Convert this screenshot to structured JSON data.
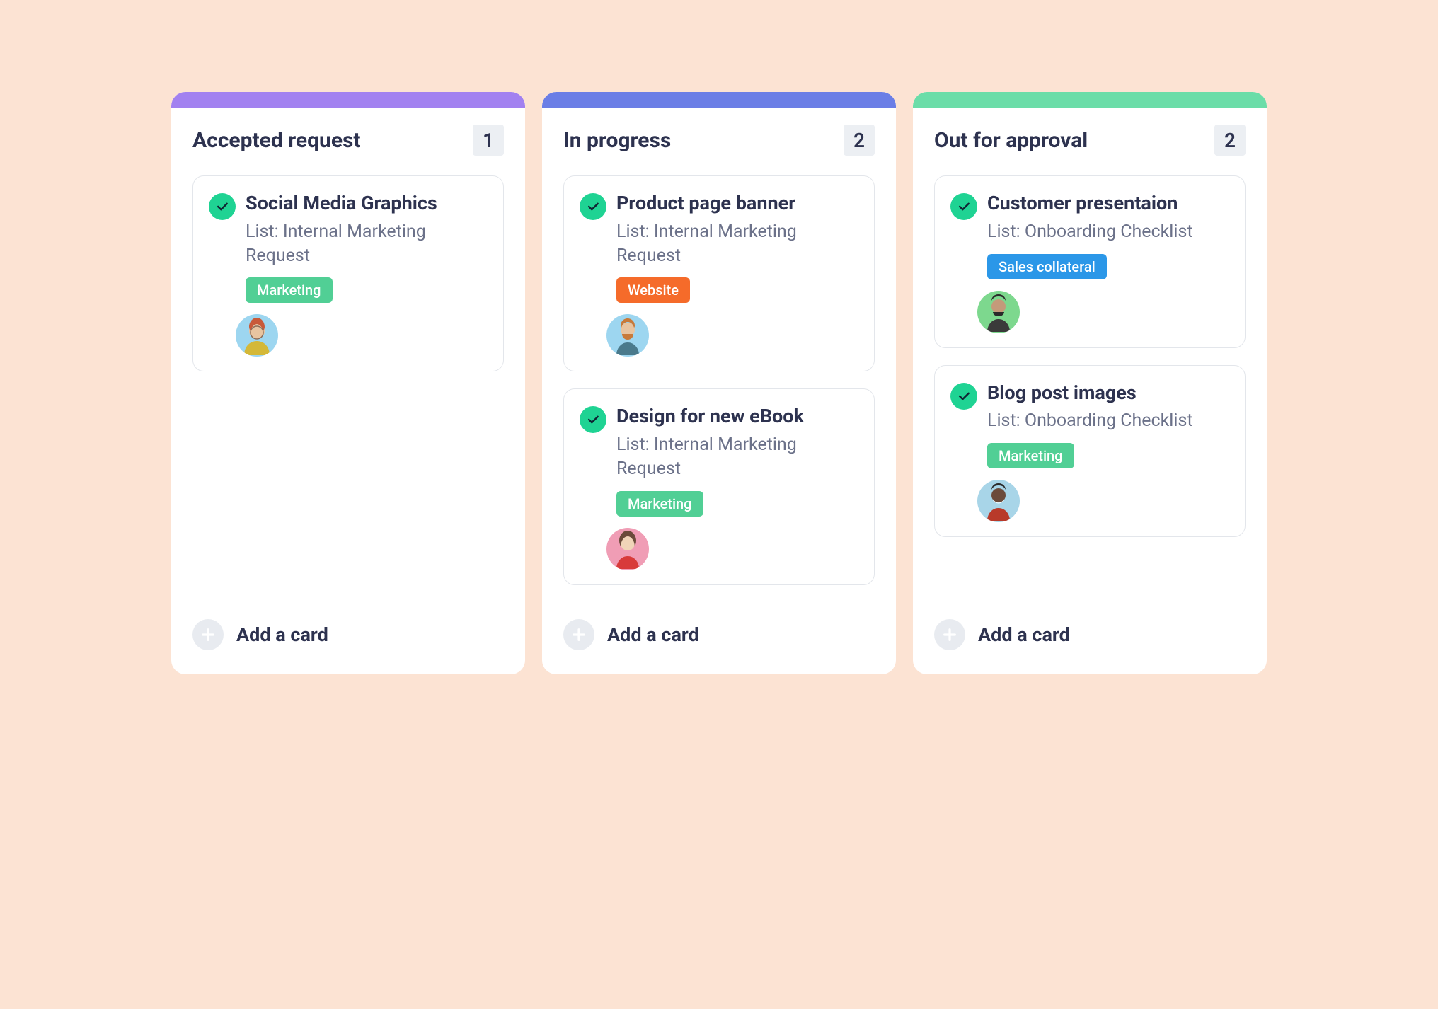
{
  "columns": [
    {
      "title": "Accepted request",
      "count": "1",
      "accentColor": "#A281F0",
      "cards": [
        {
          "title": "Social Media Graphics",
          "subtitle": "List: Internal Marketing Request",
          "tag": "Marketing",
          "tagColor": "#51CF95",
          "avatarBg": "#9DD6F0"
        }
      ],
      "addLabel": "Add a card"
    },
    {
      "title": "In progress",
      "count": "2",
      "accentColor": "#6B7EE6",
      "cards": [
        {
          "title": "Product page banner",
          "subtitle": "List: Internal Marketing Request",
          "tag": "Website",
          "tagColor": "#F56B2A",
          "avatarBg": "#9DD6F0"
        },
        {
          "title": "Design for new eBook",
          "subtitle": "List: Internal Marketing Request",
          "tag": "Marketing",
          "tagColor": "#51CF95",
          "avatarBg": "#F09DB5"
        }
      ],
      "addLabel": "Add a card"
    },
    {
      "title": "Out for approval",
      "count": "2",
      "accentColor": "#6BDDA8",
      "cards": [
        {
          "title": "Customer presentaion",
          "subtitle": "List: Onboarding Checklist",
          "tag": "Sales collateral",
          "tagColor": "#2B97E8",
          "avatarBg": "#7DD88E"
        },
        {
          "title": "Blog post images",
          "subtitle": "List: Onboarding Checklist",
          "tag": "Marketing",
          "tagColor": "#51CF95",
          "avatarBg": "#A8D5E8"
        }
      ],
      "addLabel": "Add a card"
    }
  ]
}
